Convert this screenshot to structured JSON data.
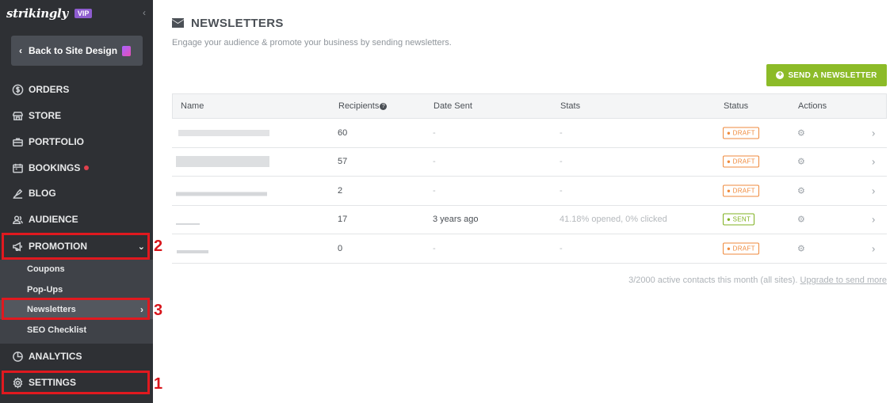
{
  "brand": {
    "name": "strikingly",
    "vip_label": "VIP"
  },
  "sidebar": {
    "back_label": "Back to Site Design",
    "items": [
      {
        "label": "ORDERS",
        "icon": "dollar-icon"
      },
      {
        "label": "STORE",
        "icon": "store-icon"
      },
      {
        "label": "PORTFOLIO",
        "icon": "briefcase-icon"
      },
      {
        "label": "BOOKINGS",
        "icon": "calendar-icon"
      },
      {
        "label": "BLOG",
        "icon": "pen-icon"
      },
      {
        "label": "AUDIENCE",
        "icon": "people-icon"
      },
      {
        "label": "PROMOTION",
        "icon": "megaphone-icon"
      },
      {
        "label": "ANALYTICS",
        "icon": "pie-chart-icon"
      },
      {
        "label": "SETTINGS",
        "icon": "gear-icon"
      }
    ],
    "promotion_sub": [
      "Coupons",
      "Pop-Ups",
      "Newsletters",
      "SEO Checklist"
    ]
  },
  "annotations": [
    "1",
    "2",
    "3"
  ],
  "page": {
    "title": "NEWSLETTERS",
    "subtitle": "Engage your audience & promote your business by sending newsletters.",
    "send_button": "SEND A NEWSLETTER"
  },
  "table": {
    "headers": [
      "Name",
      "Recipients",
      "Date Sent",
      "Stats",
      "Status",
      "Actions"
    ],
    "rows": [
      {
        "recipients": "60",
        "date": "-",
        "stats": "-",
        "status": "● DRAFT"
      },
      {
        "recipients": "57",
        "date": "-",
        "stats": "-",
        "status": "● DRAFT"
      },
      {
        "recipients": "2",
        "date": "-",
        "stats": "-",
        "status": "● DRAFT"
      },
      {
        "recipients": "17",
        "date": "3 years ago",
        "stats": "41.18% opened, 0% clicked",
        "status": "● SENT"
      },
      {
        "recipients": "0",
        "date": "-",
        "stats": "-",
        "status": "● DRAFT"
      }
    ]
  },
  "footer": {
    "text": "3/2000 active contacts this month (all sites).",
    "link": "Upgrade to send more"
  },
  "colors": {
    "sidebar": "#2e3034",
    "accent_green": "#8cbb28",
    "draft": "#ef8a3c",
    "highlight": "#e0191f"
  }
}
